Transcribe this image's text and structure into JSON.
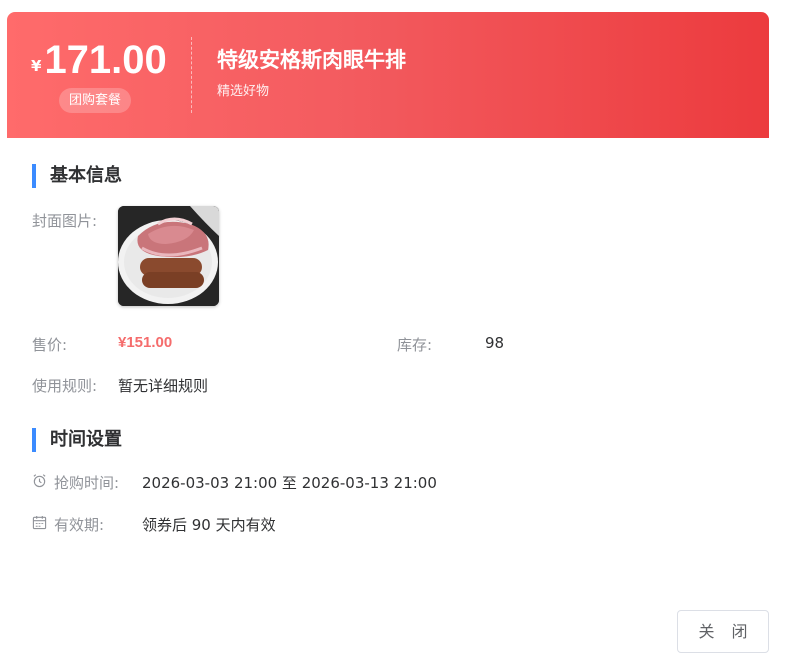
{
  "header": {
    "currency_symbol": "¥",
    "price": "171.00",
    "badge": "团购套餐",
    "title": "特级安格斯肉眼牛排",
    "subtitle": "精选好物"
  },
  "basic_info": {
    "section_title": "基本信息",
    "cover_label": "封面图片:",
    "sale_price_label": "售价:",
    "sale_price": "¥151.00",
    "stock_label": "库存:",
    "stock": "98",
    "rules_label": "使用规则:",
    "rules": "暂无详细规则"
  },
  "time_settings": {
    "section_title": "时间设置",
    "purchase_time_label": "抢购时间:",
    "purchase_time": "2026-03-03 21:00 至 2026-03-13 21:00",
    "validity_label": "有效期:",
    "validity": "领券后 90 天内有效"
  },
  "footer": {
    "close_label": "关 闭"
  },
  "icons": {
    "purchase_time": "alarm-clock-icon",
    "validity": "calendar-icon"
  },
  "colors": {
    "header_gradient_start": "#ff6b6b",
    "header_gradient_end": "#ec3b3e",
    "section_accent": "#3b8bff",
    "price_red": "#f56c6c"
  }
}
